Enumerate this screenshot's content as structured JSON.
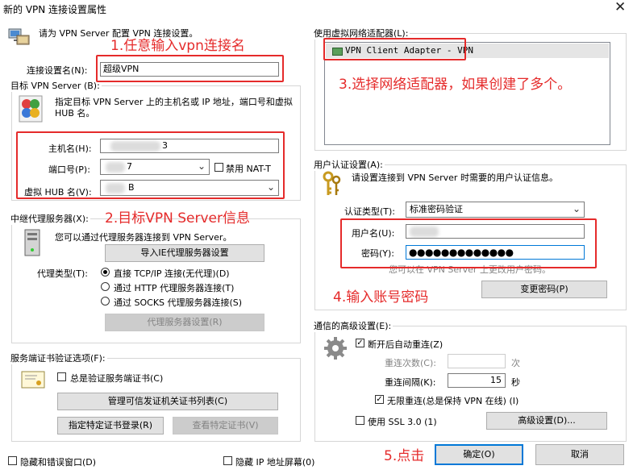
{
  "window": {
    "title": "新的 VPN 连接设置属性",
    "close": "✕"
  },
  "intro": {
    "text": "请为 VPN Server 配置 VPN 连接设置。"
  },
  "conn_name": {
    "label": "连接设置名(N):",
    "value": "超级VPN"
  },
  "target": {
    "legend": "目标 VPN Server (B):",
    "desc": "指定目标 VPN Server 上的主机名或 IP 地址，端口号和虚拟 HUB 名。",
    "host_label": "主机名(H):",
    "host_value": "3",
    "port_label": "端口号(P):",
    "port_value": "7",
    "disable_nat_label": "禁用 NAT-T",
    "hub_label": "虚拟 HUB 名(V):",
    "hub_value": "B"
  },
  "proxy": {
    "legend": "中继代理服务器(X):",
    "desc": "您可以通过代理服务器连接到 VPN Server。",
    "import_btn": "导入IE代理服务器设置",
    "type_label": "代理类型(T):",
    "options": [
      "直接 TCP/IP 连接(无代理)(D)",
      "通过 HTTP 代理服务器连接(T)",
      "通过 SOCKS 代理服务器连接(S)"
    ],
    "settings_btn": "代理服务器设置(R)"
  },
  "cert": {
    "legend": "服务端证书验证选项(F):",
    "always_verify": "总是验证服务端证书(C)",
    "manage_btn": "管理可信发证机关证书列表(C)",
    "specify_btn": "指定特定证书登录(R)",
    "view_btn": "查看特定证书(V)"
  },
  "adapter": {
    "legend": "使用虚拟网络适配器(L):",
    "item": "VPN Client Adapter - VPN"
  },
  "auth": {
    "legend": "用户认证设置(A):",
    "desc": "请设置连接到 VPN Server 时需要的用户认证信息。",
    "type_label": "认证类型(T):",
    "type_value": "标准密码验证",
    "user_label": "用户名(U):",
    "user_value": "",
    "pass_label": "密码(Y):",
    "pass_value": "●●●●●●●●●●●●●",
    "hint": "您可以在 VPN Server 上更改用户密码。",
    "change_btn": "变更密码(P)"
  },
  "advanced": {
    "legend": "通信的高级设置(E):",
    "auto_reconnect": "断开后自动重连(Z)",
    "retry_count_label": "重连次数(C):",
    "retry_count_value": "",
    "retry_unit": "次",
    "retry_interval_label": "重连间隔(K):",
    "retry_interval_value": "15",
    "interval_unit": "秒",
    "infinite_retry": "无限重连(总是保持 VPN 在线) (I)",
    "use_ssl3": "使用 SSL 3.0 (1)",
    "advanced_btn": "高级设置(D)..."
  },
  "footer": {
    "hide_status": "隐藏和错误窗口(D)",
    "hide_ip": "隐藏 IP 地址屏幕(0)",
    "ok_btn": "确定(O)",
    "cancel_btn": "取消"
  },
  "annotations": {
    "a1": "1.任意输入vpn连接名",
    "a2": "2.目标VPN Server信息",
    "a3": "3.选择网络适配器，如果创建了多个。",
    "a4": "4.输入账号密码",
    "a5": "5.点击"
  },
  "colors": {
    "annotation": "#e52b2b",
    "selection": "#cce8ff",
    "focus": "#0078d7"
  }
}
